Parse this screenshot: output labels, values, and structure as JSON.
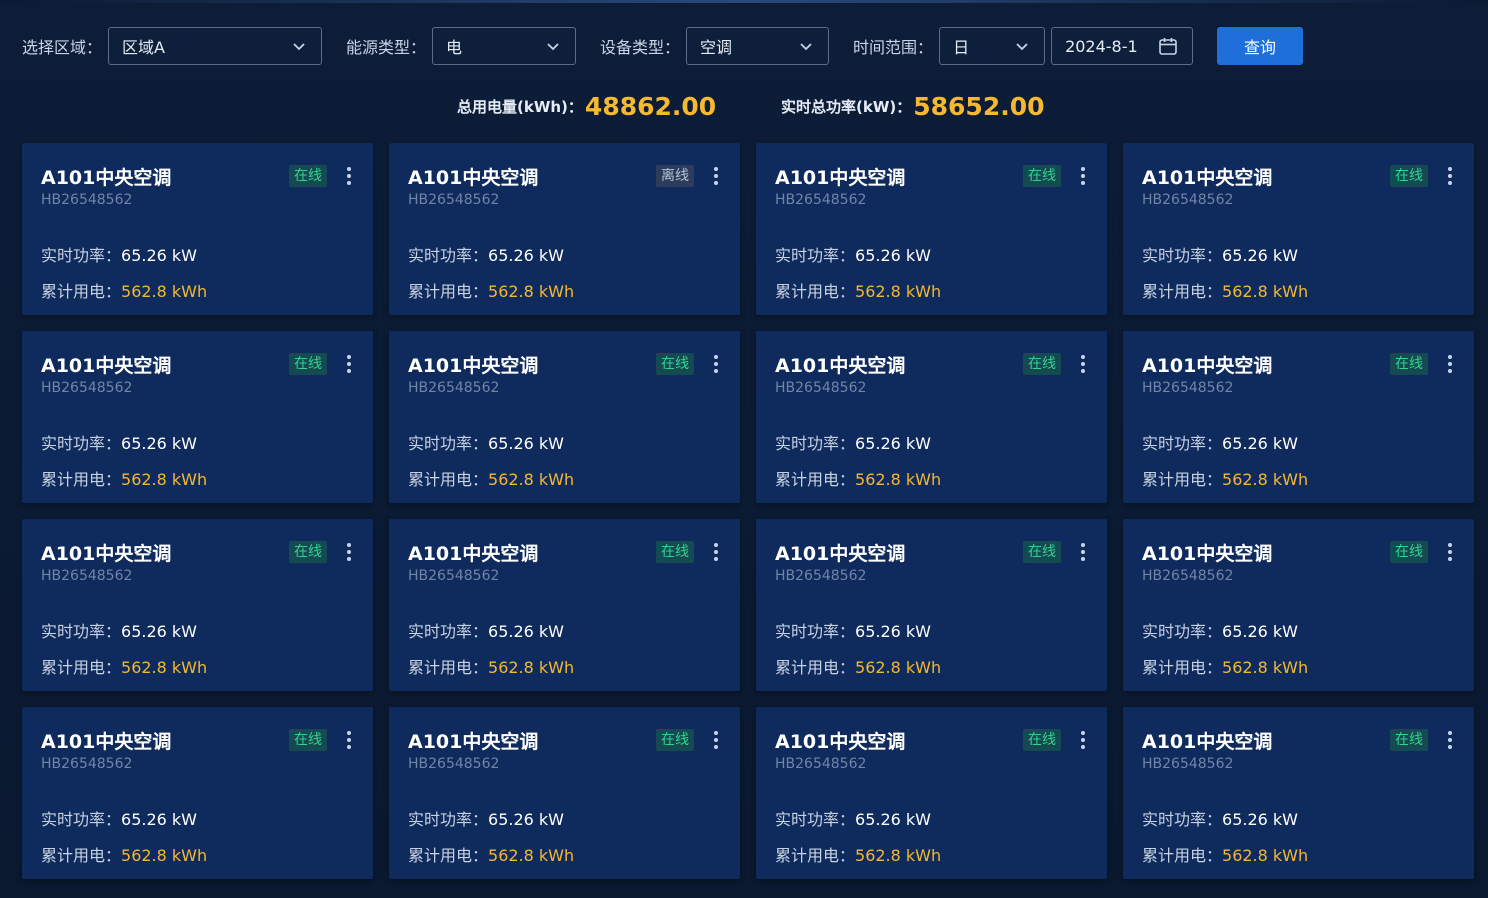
{
  "filters": {
    "region": {
      "label": "选择区域：",
      "value": "区域A"
    },
    "energy": {
      "label": "能源类型：",
      "value": "电"
    },
    "device": {
      "label": "设备类型：",
      "value": "空调"
    },
    "time": {
      "label": "时间范围：",
      "value": "日",
      "date": "2024-8-1"
    },
    "query_label": "查询"
  },
  "summary": {
    "total_energy_label": "总用电量(kWh)：",
    "total_energy_value": "48862.00",
    "total_power_label": "实时总功率(kW)：",
    "total_power_value": "58652.00"
  },
  "colors": {
    "background": "#0b1a33",
    "card": "#0f2a5c",
    "accent": "#1e6fd9",
    "highlight": "#f5b82e",
    "online": "#2fd48b"
  },
  "icons": {
    "dropdown": "chevron-down-icon",
    "date": "calendar-icon",
    "card_menu": "more-vertical-icon"
  },
  "cards": [
    {
      "title": "A101中央空调",
      "serial": "HB26548562",
      "status": "在线",
      "power_label": "实时功率：",
      "power_value": "65.26 kW",
      "energy_label": "累计用电：",
      "energy_value": "562.8 kWh"
    },
    {
      "title": "A101中央空调",
      "serial": "HB26548562",
      "status": "离线",
      "power_label": "实时功率：",
      "power_value": "65.26 kW",
      "energy_label": "累计用电：",
      "energy_value": "562.8 kWh"
    },
    {
      "title": "A101中央空调",
      "serial": "HB26548562",
      "status": "在线",
      "power_label": "实时功率：",
      "power_value": "65.26 kW",
      "energy_label": "累计用电：",
      "energy_value": "562.8 kWh"
    },
    {
      "title": "A101中央空调",
      "serial": "HB26548562",
      "status": "在线",
      "power_label": "实时功率：",
      "power_value": "65.26 kW",
      "energy_label": "累计用电：",
      "energy_value": "562.8 kWh"
    },
    {
      "title": "A101中央空调",
      "serial": "HB26548562",
      "status": "在线",
      "power_label": "实时功率：",
      "power_value": "65.26 kW",
      "energy_label": "累计用电：",
      "energy_value": "562.8 kWh"
    },
    {
      "title": "A101中央空调",
      "serial": "HB26548562",
      "status": "在线",
      "power_label": "实时功率：",
      "power_value": "65.26 kW",
      "energy_label": "累计用电：",
      "energy_value": "562.8 kWh"
    },
    {
      "title": "A101中央空调",
      "serial": "HB26548562",
      "status": "在线",
      "power_label": "实时功率：",
      "power_value": "65.26 kW",
      "energy_label": "累计用电：",
      "energy_value": "562.8 kWh"
    },
    {
      "title": "A101中央空调",
      "serial": "HB26548562",
      "status": "在线",
      "power_label": "实时功率：",
      "power_value": "65.26 kW",
      "energy_label": "累计用电：",
      "energy_value": "562.8 kWh"
    },
    {
      "title": "A101中央空调",
      "serial": "HB26548562",
      "status": "在线",
      "power_label": "实时功率：",
      "power_value": "65.26 kW",
      "energy_label": "累计用电：",
      "energy_value": "562.8 kWh"
    },
    {
      "title": "A101中央空调",
      "serial": "HB26548562",
      "status": "在线",
      "power_label": "实时功率：",
      "power_value": "65.26 kW",
      "energy_label": "累计用电：",
      "energy_value": "562.8 kWh"
    },
    {
      "title": "A101中央空调",
      "serial": "HB26548562",
      "status": "在线",
      "power_label": "实时功率：",
      "power_value": "65.26 kW",
      "energy_label": "累计用电：",
      "energy_value": "562.8 kWh"
    },
    {
      "title": "A101中央空调",
      "serial": "HB26548562",
      "status": "在线",
      "power_label": "实时功率：",
      "power_value": "65.26 kW",
      "energy_label": "累计用电：",
      "energy_value": "562.8 kWh"
    },
    {
      "title": "A101中央空调",
      "serial": "HB26548562",
      "status": "在线",
      "power_label": "实时功率：",
      "power_value": "65.26 kW",
      "energy_label": "累计用电：",
      "energy_value": "562.8 kWh"
    },
    {
      "title": "A101中央空调",
      "serial": "HB26548562",
      "status": "在线",
      "power_label": "实时功率：",
      "power_value": "65.26 kW",
      "energy_label": "累计用电：",
      "energy_value": "562.8 kWh"
    },
    {
      "title": "A101中央空调",
      "serial": "HB26548562",
      "status": "在线",
      "power_label": "实时功率：",
      "power_value": "65.26 kW",
      "energy_label": "累计用电：",
      "energy_value": "562.8 kWh"
    },
    {
      "title": "A101中央空调",
      "serial": "HB26548562",
      "status": "在线",
      "power_label": "实时功率：",
      "power_value": "65.26 kW",
      "energy_label": "累计用电：",
      "energy_value": "562.8 kWh"
    }
  ]
}
